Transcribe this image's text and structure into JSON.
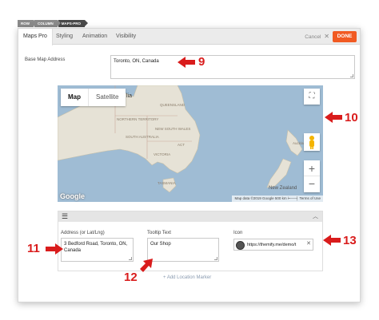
{
  "breadcrumb": [
    "ROW",
    "COLUMN",
    "MAPS-PRO"
  ],
  "tabs": [
    {
      "label": "Maps Pro",
      "active": true
    },
    {
      "label": "Styling",
      "active": false
    },
    {
      "label": "Animation",
      "active": false
    },
    {
      "label": "Visibility",
      "active": false
    }
  ],
  "header": {
    "cancel_label": "Cancel",
    "done_label": "DONE"
  },
  "base_map": {
    "label": "Base Map Address",
    "value": "Toronto, ON, Canada"
  },
  "map": {
    "type_buttons": [
      "Map",
      "Satellite"
    ],
    "zoom_in": "+",
    "zoom_out": "−",
    "logo": "Google",
    "attribution": "Map data ©2019 Google   500 km ⊢──┤   Terms of Use",
    "places": [
      "NORTHERN TERRITORY",
      "QUEENSLAND",
      "SOUTH AUSTRALIA",
      "NEW SOUTH WALES",
      "ACT",
      "VICTORIA",
      "TASMANIA",
      "Auckland",
      "New Zealand"
    ],
    "partial_label": "lia"
  },
  "marker": {
    "address_label": "Address (or Lat/Lng)",
    "address_value": "3 Bedford Road, Toronto, ON, Canada",
    "tooltip_label": "Tooltip Text",
    "tooltip_value": "Our Shop",
    "icon_label": "Icon",
    "icon_url": "https://themify.me/demo/t",
    "add_label": "+ Add Location Marker"
  },
  "annotations": [
    "9",
    "10",
    "11",
    "12",
    "13"
  ],
  "colors": {
    "accent": "#f15a22",
    "arrow": "#d91c1c",
    "water": "#9fbcd4",
    "land": "#e8e4da"
  }
}
